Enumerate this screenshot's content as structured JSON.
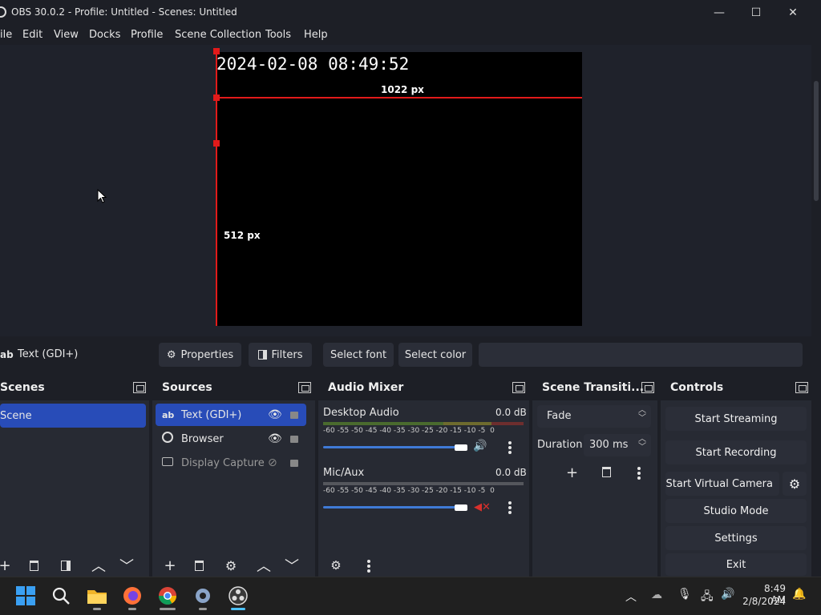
{
  "window": {
    "title": "OBS 30.0.2 - Profile: Untitled - Scenes: Untitled",
    "minimize": "—",
    "maximize": "☐",
    "close": "✕"
  },
  "menu": [
    "ile",
    "Edit",
    "View",
    "Docks",
    "Profile",
    "Scene Collection",
    "Tools",
    "Help"
  ],
  "preview": {
    "timestamp": "2024-02-08 08:49:52",
    "width_label": "1022 px",
    "height_label": "512 px"
  },
  "context_bar": {
    "source_label": "Text (GDI+)",
    "properties": "Properties",
    "filters": "Filters",
    "select_font": "Select font",
    "select_color": "Select color"
  },
  "scenes": {
    "title": "Scenes",
    "items": [
      "Scene"
    ]
  },
  "sources": {
    "title": "Sources",
    "items": [
      {
        "label": "Text (GDI+)",
        "icon": "text-icon",
        "visible": true,
        "selected": true
      },
      {
        "label": "Browser",
        "icon": "globe-icon",
        "visible": true,
        "selected": false
      },
      {
        "label": "Display Capture",
        "icon": "monitor-icon",
        "visible": false,
        "selected": false
      }
    ]
  },
  "audio_mixer": {
    "title": "Audio Mixer",
    "channels": [
      {
        "name": "Desktop Audio",
        "level": "0.0 dB",
        "muted": false,
        "volume": 1.0
      },
      {
        "name": "Mic/Aux",
        "level": "0.0 dB",
        "muted": true,
        "volume": 1.0
      }
    ],
    "scale": [
      "-60",
      "-55",
      "-50",
      "-45",
      "-40",
      "-35",
      "-30",
      "-25",
      "-20",
      "-15",
      "-10",
      "-5",
      "0"
    ]
  },
  "transitions": {
    "title": "Scene Transiti...",
    "selected": "Fade",
    "duration_label": "Duration",
    "duration_value": "300 ms"
  },
  "controls": {
    "title": "Controls",
    "start_streaming": "Start Streaming",
    "start_recording": "Start Recording",
    "start_virtual_camera": "Start Virtual Camera",
    "studio_mode": "Studio Mode",
    "settings": "Settings",
    "exit": "Exit"
  },
  "taskbar": {
    "time": "8:49 AM",
    "date": "2/8/2024"
  },
  "colors": {
    "accent": "#284cb8",
    "marker": "#e21a1a",
    "muted": "#d9302c"
  }
}
